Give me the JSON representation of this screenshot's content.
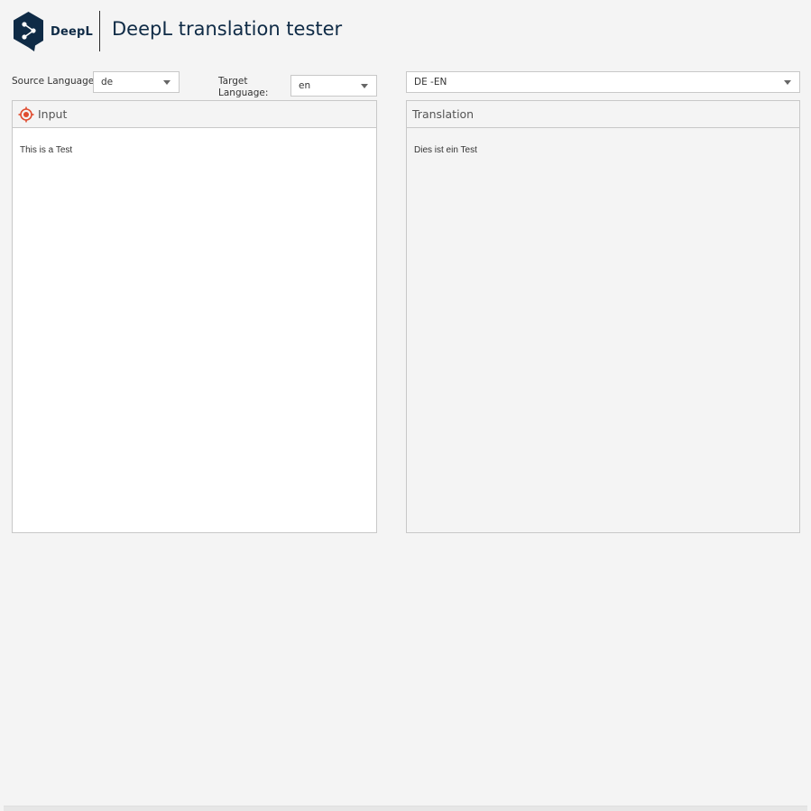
{
  "header": {
    "logo_text": "DeepL",
    "title": "DeepL translation tester"
  },
  "controls": {
    "source_language_label": "Source Language:",
    "source_language_value": "de",
    "target_language_label_line1": "Target",
    "target_language_label_line2": "Language:",
    "target_language_value": "en",
    "pair_select_value": "DE -EN"
  },
  "input_panel": {
    "title": "Input",
    "text": "This is a Test"
  },
  "translation_panel": {
    "title": "Translation",
    "text": "Dies ist ein Test"
  },
  "icons": {
    "logo": "deepl-logo-icon",
    "input": "target-icon",
    "dropdown": "chevron-down-icon"
  },
  "colors": {
    "brand_navy": "#0f2b46",
    "accent_red": "#e04c2f",
    "background": "#f4f4f4"
  }
}
